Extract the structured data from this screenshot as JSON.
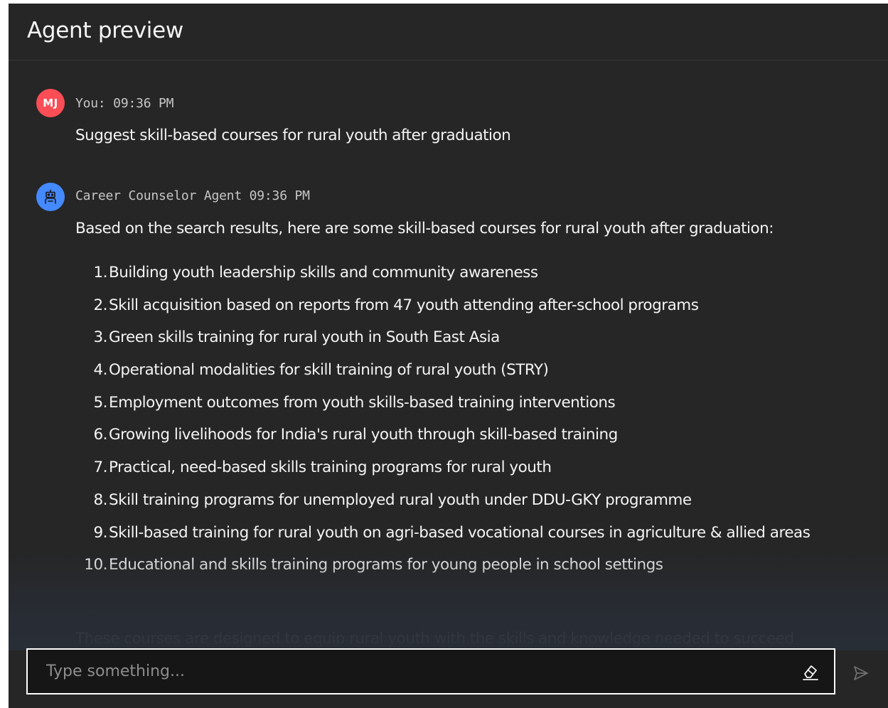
{
  "header": {
    "title": "Agent preview"
  },
  "messages": {
    "user": {
      "avatar_initials": "MJ",
      "meta": "You: 09:36 PM",
      "text": "Suggest skill-based courses for rural youth after graduation"
    },
    "agent": {
      "avatar_icon": "robot-icon",
      "meta": "Career Counselor Agent 09:36 PM",
      "intro": "Based on the search results, here are some skill-based courses for rural youth after graduation:",
      "courses": [
        {
          "num": "1.",
          "text": "Building youth leadership skills and community awareness"
        },
        {
          "num": "2.",
          "text": "Skill acquisition based on reports from 47 youth attending after-school programs"
        },
        {
          "num": "3.",
          "text": "Green skills training for rural youth in South East Asia"
        },
        {
          "num": "4.",
          "text": "Operational modalities for skill training of rural youth (STRY)"
        },
        {
          "num": "5.",
          "text": "Employment outcomes from youth skills-based training interventions"
        },
        {
          "num": "6.",
          "text": "Growing livelihoods for India's rural youth through skill-based training"
        },
        {
          "num": "7.",
          "text": "Practical, need-based skills training programs for rural youth"
        },
        {
          "num": "8.",
          "text": "Skill training programs for unemployed rural youth under DDU-GKY programme"
        },
        {
          "num": "9.",
          "text": "Skill-based training for rural youth on agri-based vocational courses in agriculture & allied areas"
        },
        {
          "num": "10.",
          "text": "Educational and skills training programs for young people in school settings"
        }
      ],
      "closing": "These courses are designed to equip rural youth with the skills and knowledge needed to succeed"
    }
  },
  "input": {
    "placeholder": "Type something..."
  },
  "icons": {
    "clear": "eraser-icon",
    "send": "send-icon"
  },
  "colors": {
    "user_avatar": "#fa4d56",
    "agent_avatar": "#4589ff",
    "panel_bg": "#262626"
  }
}
